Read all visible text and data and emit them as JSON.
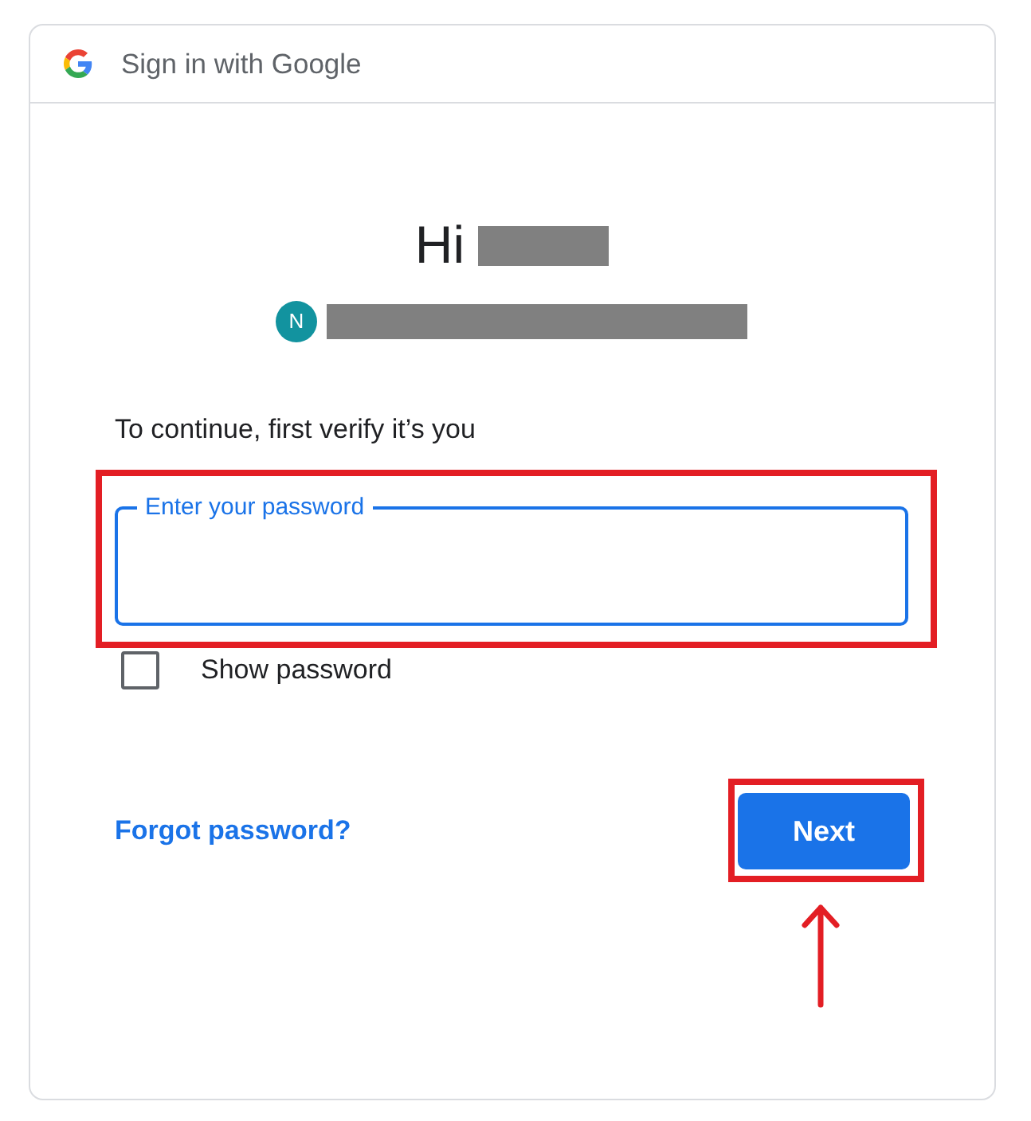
{
  "window": {
    "title": "Sign in with Google"
  },
  "greeting": {
    "text": "Hi",
    "name_redacted": true
  },
  "account": {
    "initial": "N",
    "email_redacted": true
  },
  "prompt": "To continue, first verify it’s you",
  "password_field": {
    "label": "Enter your password",
    "focused": true,
    "highlighted": true
  },
  "show_password": {
    "label": "Show password",
    "checked": false
  },
  "forgot_link": {
    "label": "Forgot password?"
  },
  "next_button": {
    "label": "Next",
    "highlighted": true,
    "pointer_arrow": true
  }
}
